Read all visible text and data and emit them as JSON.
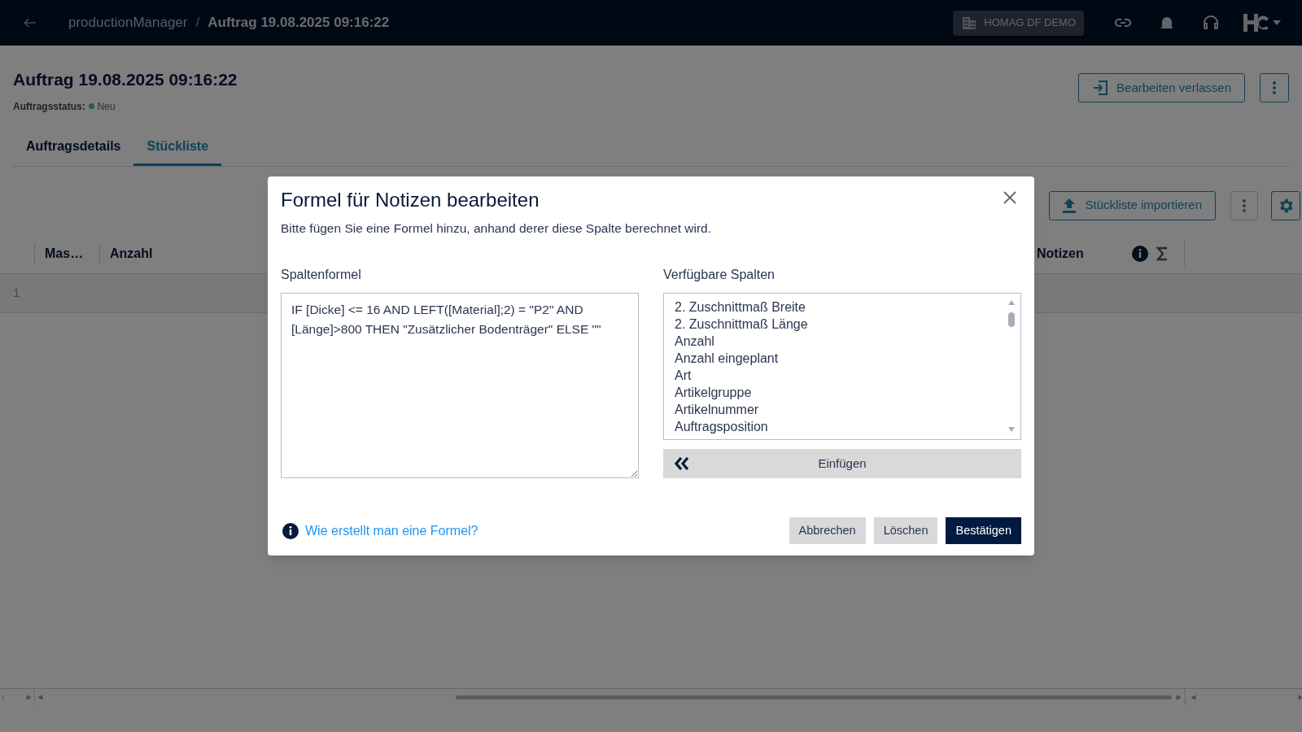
{
  "top_bar": {
    "breadcrumb": [
      {
        "label": "productionManager",
        "current": false
      },
      {
        "label": "Auftrag 19.08.2025 09:16:22",
        "current": true
      }
    ],
    "separator": "/",
    "tenant": "HOMAG DF DEMO"
  },
  "header": {
    "title": "Auftrag 19.08.2025 09:16:22",
    "status_label": "Auftragsstatus:",
    "status": "Neu",
    "exit_button": "Bearbeiten verlassen"
  },
  "tabs": [
    {
      "label": "Auftragsdetails",
      "selected": false
    },
    {
      "label": "Stückliste",
      "selected": true
    }
  ],
  "toolbar": {
    "import_button": "Stückliste importieren"
  },
  "table": {
    "columns": [
      "Mas…",
      "Anzahl",
      "Notizen"
    ],
    "rows": [
      "1"
    ]
  },
  "dialog": {
    "title": "Formel für Notizen bearbeiten",
    "description": "Bitte fügen Sie eine Formel hinzu, anhand derer diese Spalte berechnet wird.",
    "formula_label": "Spaltenformel",
    "formula": "IF [Dicke] <= 16 AND LEFT([Material];2) = \"P2\" AND [Länge]>800 THEN \"Zusätzlicher Bodenträger\" ELSE \"\"",
    "columns_label": "Verfügbare Spalten",
    "columns": [
      "2. Zuschnittmaß Breite",
      "2. Zuschnittmaß Länge",
      "Anzahl",
      "Anzahl eingeplant",
      "Art",
      "Artikelgruppe",
      "Artikelnummer",
      "Auftragsposition"
    ],
    "insert_button": "Einfügen",
    "help_link": "Wie erstellt man eine Formel?",
    "buttons": [
      {
        "label": "Abbrechen",
        "kind": "secondary"
      },
      {
        "label": "Löschen",
        "kind": "secondary"
      },
      {
        "label": "Bestätigen",
        "kind": "primary"
      }
    ]
  }
}
